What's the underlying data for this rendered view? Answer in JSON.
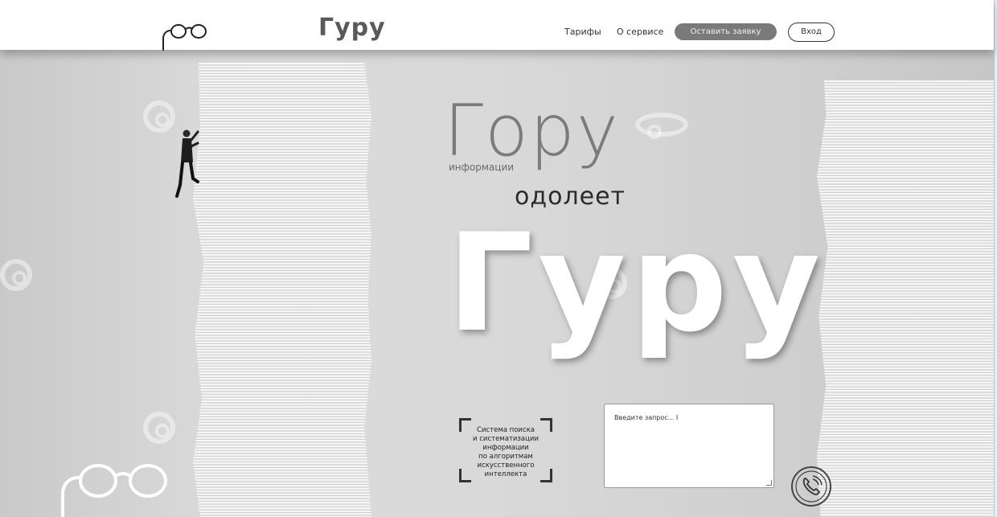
{
  "header": {
    "brand": "Гуру",
    "nav": {
      "tariffs": "Тарифы",
      "about": "О сервисе",
      "request": "Оставить заявку",
      "login": "Вход"
    }
  },
  "hero": {
    "gory": "Гору",
    "info": "информации",
    "odoleet": "одолеет",
    "guru": "Гуру"
  },
  "description": "Система поиска\nи систематизации\nинформации\nпо алгоритмам\nискусственного\nинтеллекта",
  "query": {
    "placeholder": "Введите запрос... I"
  },
  "icons": {
    "logo": "glasses-icon",
    "phone": "phone-icon",
    "man": "climbing-man"
  },
  "colors": {
    "header_bg": "#ffffff",
    "request_button": "#7a7a7a",
    "hero_white": "#ffffff"
  }
}
